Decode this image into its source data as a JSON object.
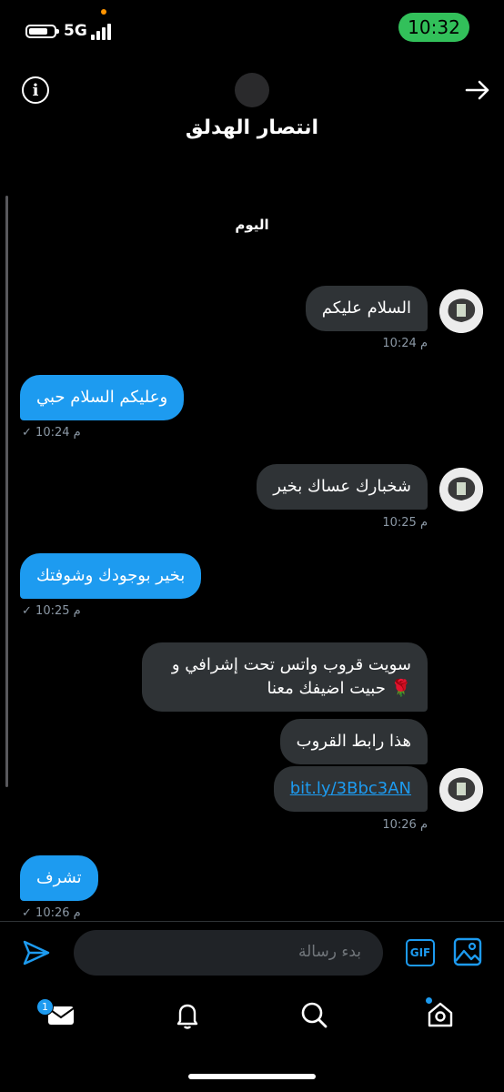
{
  "status_bar": {
    "network": "5G",
    "time": "10:32"
  },
  "header": {
    "title": "انتصار الهدلق",
    "info_glyph": "i"
  },
  "chat": {
    "day_label": "اليوم",
    "messages": [
      {
        "dir": "in",
        "text": "السلام عليكم",
        "time": "10:24 م"
      },
      {
        "dir": "out",
        "text": "وعليكم السلام حبي",
        "time": "10:24 م",
        "status": "✓"
      },
      {
        "dir": "in",
        "text": "شخبارك عساك بخير",
        "time": "10:25 م"
      },
      {
        "dir": "out",
        "text": "بخير بوجودك وشوفتك",
        "time": "10:25 م",
        "status": "✓"
      },
      {
        "dir": "in",
        "text": "سويت قروب واتس تحت إشرافي و حبيت اضيفك معنا 🌹"
      },
      {
        "dir": "in",
        "text": "هذا رابط القروب"
      },
      {
        "dir": "in",
        "text": "bit.ly/3Bbc3AN",
        "is_link": true,
        "time": "10:26 م"
      },
      {
        "dir": "out",
        "text": "تشرف",
        "time": "10:26 م",
        "status": "✓"
      }
    ]
  },
  "composer": {
    "placeholder": "بدء رسالة",
    "gif_label": "GIF"
  },
  "tab_bar": {
    "messages_badge": "1"
  },
  "colors": {
    "accent": "#1d9bf0",
    "incoming_bubble": "#2f3336",
    "time_pill": "#32c05a",
    "notification_dot": "#ff9500"
  }
}
